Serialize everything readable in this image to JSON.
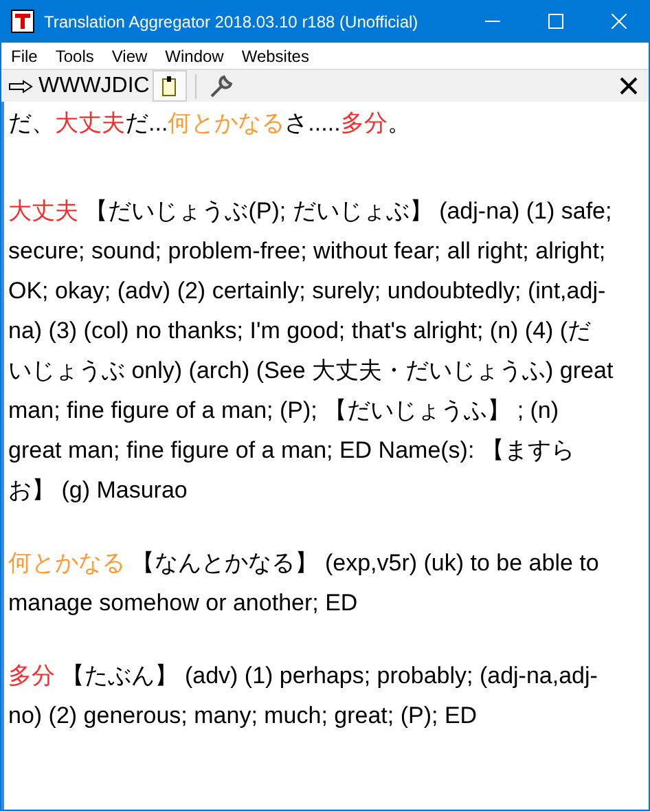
{
  "window": {
    "title": "Translation Aggregator 2018.03.10 r188 (Unofficial)"
  },
  "menu": [
    "File",
    "Tools",
    "View",
    "Window",
    "Websites"
  ],
  "toolbar": {
    "dictionary": "WWWJDIC",
    "clipboard_on": true
  },
  "sentence": [
    {
      "text": "だ、",
      "color": "#000000"
    },
    {
      "text": "大丈夫",
      "color": "#ff2a2a"
    },
    {
      "text": "だ...",
      "color": "#000000"
    },
    {
      "text": "何とかなる",
      "color": "#ff9a33"
    },
    {
      "text": "さ.....",
      "color": "#000000"
    },
    {
      "text": "多分",
      "color": "#ff2a2a"
    },
    {
      "text": "。",
      "color": "#000000"
    }
  ],
  "entries": [
    {
      "headword": "大丈夫",
      "color": "#ff2a2a",
      "definition": "【だいじょうぶ(P); だいじょぶ】 (adj-na) (1) safe; secure; sound; problem-free; without fear; all right; alright; OK; okay; (adv) (2) certainly; surely; undoubtedly; (int,adj-na) (3) (col) no thanks; I'm good; that's alright; (n) (4) (だいじょうぶ only) (arch) (See 大丈夫・だいじょうふ) great man; fine figure of a man; (P); 【だいじょうふ】 ; (n) great man; fine figure of a man; ED Name(s): 【ますらお】 (g) Masurao"
    },
    {
      "headword": "何とかなる",
      "color": "#ff9a33",
      "definition": "【なんとかなる】 (exp,v5r) (uk) to be able to manage somehow or another; ED"
    },
    {
      "headword": "多分",
      "color": "#ff2a2a",
      "definition": "【たぶん】 (adv) (1) perhaps; probably; (adj-na,adj-no) (2) generous; many; much; great; (P); ED"
    }
  ]
}
